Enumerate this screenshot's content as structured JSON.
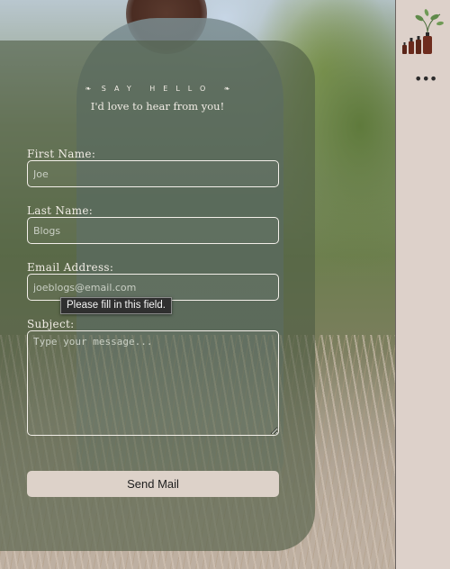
{
  "form": {
    "eyebrow": "SAY HELLO",
    "tagline": "I'd love to hear from you!",
    "first_name": {
      "label": "First Name:",
      "placeholder": "Joe"
    },
    "last_name": {
      "label": "Last Name:",
      "placeholder": "Blogs"
    },
    "email": {
      "label": "Email Address:",
      "placeholder": "joeblogs@email.com"
    },
    "subject": {
      "label": "Subject:",
      "placeholder": "Type your message..."
    },
    "validation_tooltip": "Please fill in this field.",
    "submit_label": "Send Mail"
  },
  "sidebar": {
    "logo_icon": "plant-bottles-logo-icon",
    "menu_icon": "more-dots-icon",
    "menu_glyph": "•••"
  },
  "colors": {
    "panel": "#4e5c44",
    "button": "#ddd2c9",
    "sidebar": "#ddd1ca",
    "text_light": "#f1ece5"
  }
}
